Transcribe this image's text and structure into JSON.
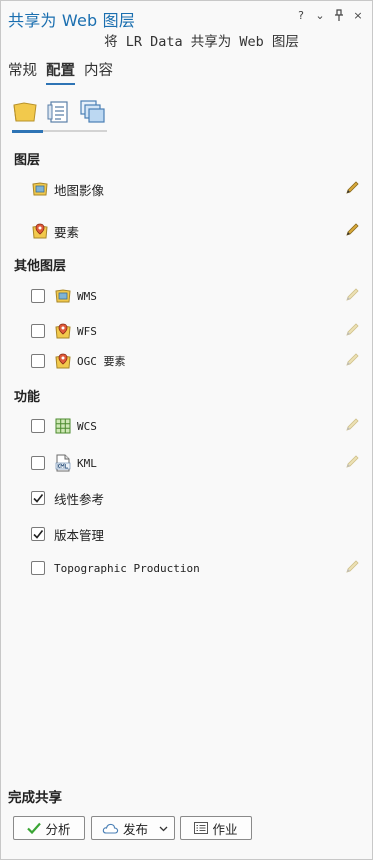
{
  "window": {
    "title": "共享为 Web 图层",
    "subtitle": "将 LR Data 共享为 Web 图层",
    "tools": [
      "?",
      "⌄",
      "⊥",
      "×"
    ]
  },
  "tabs": [
    {
      "label": "常规",
      "active": false
    },
    {
      "label": "配置",
      "active": true
    },
    {
      "label": "内容",
      "active": false
    }
  ],
  "icon_tabs": [
    {
      "icon": "layers-folder-icon",
      "active": true
    },
    {
      "icon": "properties-list-icon",
      "active": false
    },
    {
      "icon": "stacked-layers-icon",
      "active": false
    }
  ],
  "layers": {
    "heading": "图层",
    "items": [
      {
        "label": "地图影像",
        "icon": "map-image-icon"
      },
      {
        "label": "要素",
        "icon": "feature-icon"
      }
    ]
  },
  "other_layers": {
    "heading": "其他图层",
    "items": [
      {
        "label": "WMS",
        "checked": false,
        "icon": "wms-icon"
      },
      {
        "label": "WFS",
        "checked": false,
        "icon": "wfs-icon"
      },
      {
        "label": "OGC 要素",
        "checked": false,
        "icon": "ogc-feature-icon"
      }
    ]
  },
  "capabilities": {
    "heading": "功能",
    "items": [
      {
        "label": "WCS",
        "checked": false,
        "icon": "wcs-grid-icon"
      },
      {
        "label": "KML",
        "checked": false,
        "icon": "kml-icon"
      },
      {
        "label": "线性参考",
        "checked": true
      },
      {
        "label": "版本管理",
        "checked": true
      },
      {
        "label": "Topographic Production",
        "checked": false
      }
    ]
  },
  "footer": {
    "heading": "完成共享",
    "analyze_label": "分析",
    "publish_label": "发布",
    "jobs_label": "作业"
  },
  "colors": {
    "accent": "#2e74b5",
    "title": "#1b6fb0",
    "pencil_active": "#c8a23a",
    "pencil_disabled": "#e4d9a8"
  }
}
